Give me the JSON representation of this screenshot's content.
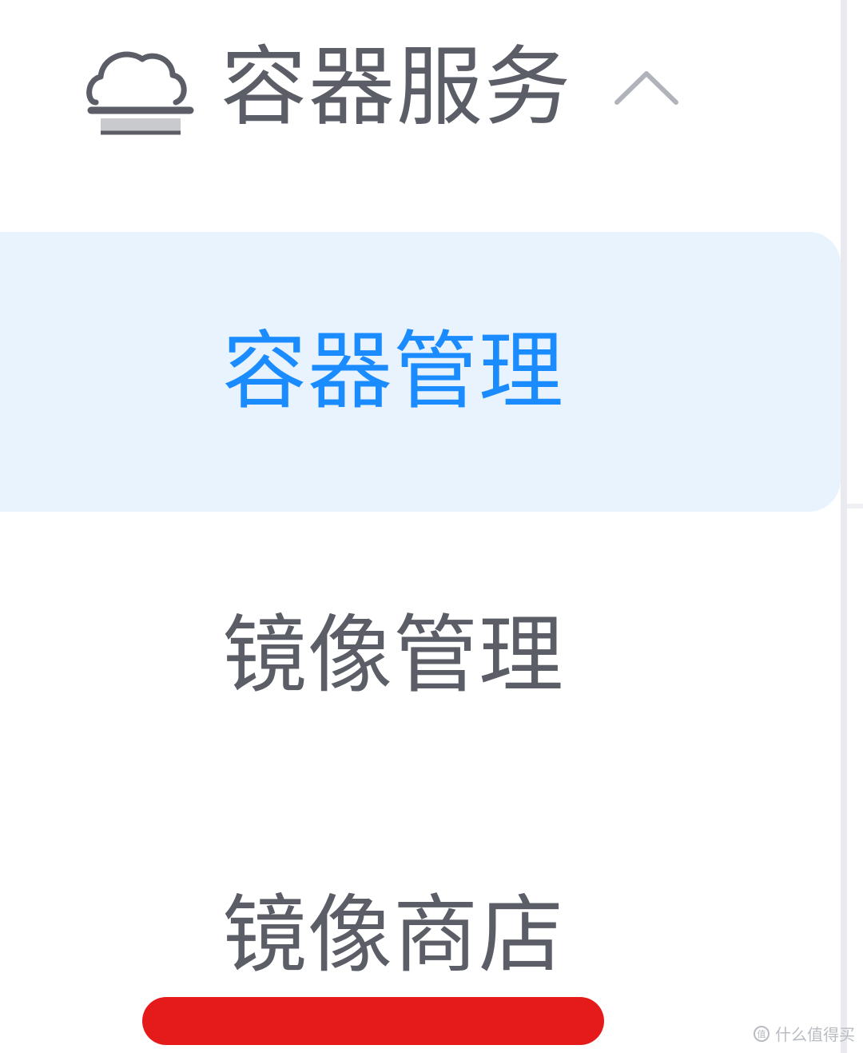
{
  "nav": {
    "group": {
      "title": "容器服务",
      "icon": "cloud-icon",
      "toggle_icon": "chevron-up-icon",
      "expanded": true
    },
    "items": [
      {
        "label": "容器管理",
        "active": true
      },
      {
        "label": "镜像管理",
        "active": false
      },
      {
        "label": "镜像商店",
        "active": false
      }
    ]
  },
  "annotation": {
    "type": "red-underline-highlight",
    "target": "镜像商店",
    "color": "#e51b1b"
  },
  "watermark": {
    "text": "什么值得买"
  },
  "colors": {
    "active_text": "#1a8cff",
    "active_bg": "#e8f3fd",
    "text": "#5b5e66",
    "divider": "#e8eaef"
  }
}
